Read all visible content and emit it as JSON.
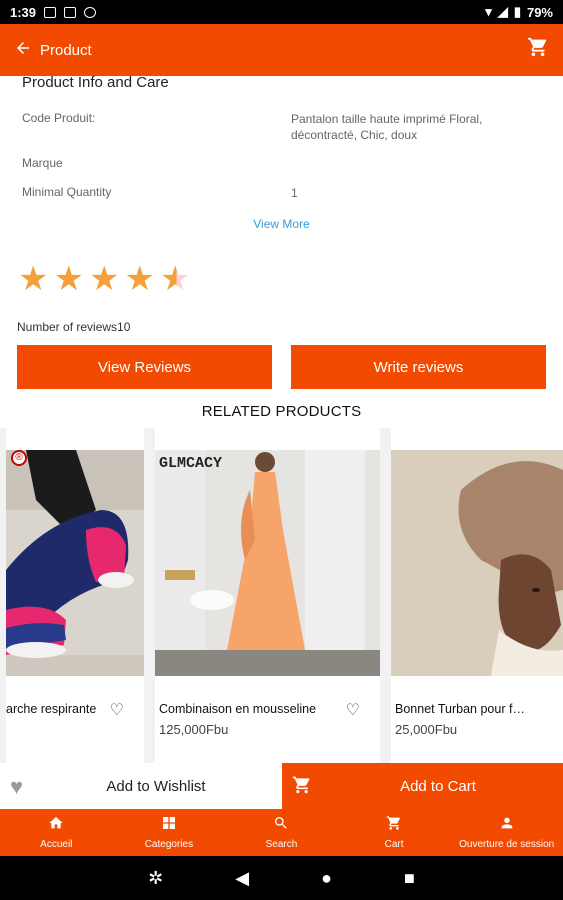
{
  "status_bar": {
    "time": "1:39",
    "battery": "79%"
  },
  "app_bar": {
    "title": "Product",
    "back_icon": "arrow-left-icon",
    "cart_icon": "cart-icon"
  },
  "info": {
    "heading": "Product Info and Care",
    "rows": [
      {
        "label": "Code Produit:",
        "value": "Pantalon taille haute imprimé Floral, décontracté, Chic, doux"
      },
      {
        "label": "Marque",
        "value": ""
      },
      {
        "label": "Minimal Quantity",
        "value": "1"
      }
    ],
    "view_more": "View More"
  },
  "rating": {
    "stars": 4.5,
    "reviews_text": "Number of reviews10"
  },
  "buttons": {
    "view_reviews": "View Reviews",
    "write_reviews": "Write reviews"
  },
  "related": {
    "title": "RELATED PRODUCTS",
    "products": [
      {
        "name": "arche respirante",
        "price": ""
      },
      {
        "name": "Combinaison en mousseline",
        "price": "125,000Fbu",
        "brand_text": "GLMCACY"
      },
      {
        "name": "Bonnet Turban pour femme",
        "price": "25,000Fbu"
      }
    ]
  },
  "actions": {
    "wishlist": "Add to Wishlist",
    "cart": "Add to Cart"
  },
  "bottom_nav": [
    {
      "label": "Accueil",
      "icon": "home-icon"
    },
    {
      "label": "Categories",
      "icon": "grid-icon"
    },
    {
      "label": "Search",
      "icon": "search-icon"
    },
    {
      "label": "Cart",
      "icon": "cart-icon"
    },
    {
      "label": "Ouverture de session",
      "icon": "user-icon"
    }
  ],
  "colors": {
    "accent": "#f24a00",
    "star": "#f6a03b",
    "link": "#3a9ad9"
  }
}
